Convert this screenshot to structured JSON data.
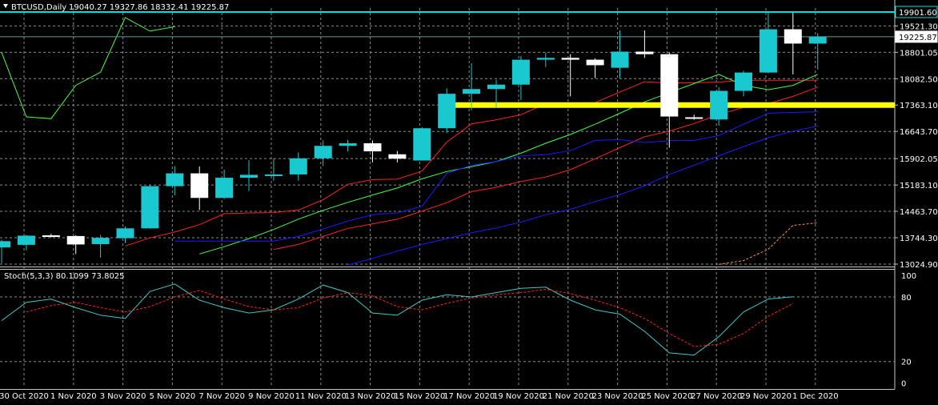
{
  "header": {
    "symbol_label": "BTCUSD,Daily",
    "ohlc_label": "19040.27 19327.86 18332.41 19225.87",
    "stoch_label": "Stoch(5,3,3) 80.1099 73.8025"
  },
  "colors": {
    "bull_candle": "#1ac8d0",
    "bear_candle": "#ffffff",
    "grid": "#8a8a8a",
    "highlight_line": "#ffff00",
    "resistance_line": "#00e0e0",
    "ma_fast": "#ff2020",
    "ma_mid": "#40ff40",
    "ma_slow": "#1a1aff",
    "stoch_main": "#40c8c8",
    "stoch_signal": "#ff2020",
    "dotted_indicator": "#ff9040"
  },
  "chart_data": [
    {
      "type": "candlestick",
      "title": "BTCUSD,Daily",
      "y_axis_labels": [
        "19521.30",
        "18801.05",
        "18082.50",
        "17363.10",
        "16643.70",
        "15902.05",
        "15183.10",
        "14463.70",
        "13744.30",
        "13024.90"
      ],
      "y_axis_values": [
        19521.3,
        18801.05,
        18082.5,
        17363.1,
        16643.7,
        15902.05,
        15183.1,
        14463.7,
        13744.3,
        13024.9
      ],
      "ylim": [
        12980,
        20010
      ],
      "price_labels": [
        {
          "text": "19901.60",
          "value": 19901.6,
          "style": "resistance"
        },
        {
          "text": "19225.87",
          "value": 19225.87,
          "style": "current"
        }
      ],
      "horizontal_levels": [
        {
          "name": "resistance",
          "value": 19901.6
        },
        {
          "name": "current-price",
          "value": 19225.87
        },
        {
          "name": "highlighted-support",
          "value": 17363.1,
          "from_index": 18
        }
      ],
      "x_labels": [
        "30 Oct 2020",
        "1 Nov 2020",
        "3 Nov 2020",
        "5 Nov 2020",
        "7 Nov 2020",
        "9 Nov 2020",
        "11 Nov 2020",
        "13 Nov 2020",
        "15 Nov 2020",
        "17 Nov 2020",
        "19 Nov 2020",
        "21 Nov 2020",
        "23 Nov 2020",
        "25 Nov 2020",
        "27 Nov 2020",
        "29 Nov 2020",
        "1 Dec 2020"
      ],
      "candles": [
        {
          "o": 13480,
          "h": 13690,
          "l": 13050,
          "c": 13650
        },
        {
          "o": 13550,
          "h": 13820,
          "l": 13400,
          "c": 13800
        },
        {
          "o": 13810,
          "h": 13850,
          "l": 13750,
          "c": 13780
        },
        {
          "o": 13790,
          "h": 13810,
          "l": 13300,
          "c": 13560
        },
        {
          "o": 13570,
          "h": 13820,
          "l": 13200,
          "c": 13740
        },
        {
          "o": 13730,
          "h": 14050,
          "l": 13600,
          "c": 14000
        },
        {
          "o": 14000,
          "h": 15200,
          "l": 13990,
          "c": 15150
        },
        {
          "o": 15150,
          "h": 15700,
          "l": 14900,
          "c": 15500
        },
        {
          "o": 15500,
          "h": 15690,
          "l": 14500,
          "c": 14830
        },
        {
          "o": 14830,
          "h": 15600,
          "l": 14800,
          "c": 15380
        },
        {
          "o": 15380,
          "h": 15860,
          "l": 15020,
          "c": 15460
        },
        {
          "o": 15460,
          "h": 15900,
          "l": 15300,
          "c": 15470
        },
        {
          "o": 15470,
          "h": 16070,
          "l": 15300,
          "c": 15910
        },
        {
          "o": 15910,
          "h": 16400,
          "l": 15700,
          "c": 16250
        },
        {
          "o": 16250,
          "h": 16410,
          "l": 16100,
          "c": 16320
        },
        {
          "o": 16320,
          "h": 16400,
          "l": 15800,
          "c": 16100
        },
        {
          "o": 16020,
          "h": 16110,
          "l": 15800,
          "c": 15900
        },
        {
          "o": 15850,
          "h": 16760,
          "l": 15850,
          "c": 16730
        },
        {
          "o": 16730,
          "h": 17820,
          "l": 16600,
          "c": 17670
        },
        {
          "o": 17670,
          "h": 18500,
          "l": 17220,
          "c": 17800
        },
        {
          "o": 17800,
          "h": 18050,
          "l": 17300,
          "c": 17920
        },
        {
          "o": 17920,
          "h": 18700,
          "l": 17500,
          "c": 18600
        },
        {
          "o": 18600,
          "h": 18800,
          "l": 18400,
          "c": 18650
        },
        {
          "o": 18650,
          "h": 18750,
          "l": 17600,
          "c": 18600
        },
        {
          "o": 18600,
          "h": 18640,
          "l": 18100,
          "c": 18450
        },
        {
          "o": 18380,
          "h": 19400,
          "l": 18100,
          "c": 18820
        },
        {
          "o": 18820,
          "h": 19400,
          "l": 18650,
          "c": 18750
        },
        {
          "o": 18750,
          "h": 18790,
          "l": 16200,
          "c": 17050
        },
        {
          "o": 17030,
          "h": 17100,
          "l": 16960,
          "c": 17000
        },
        {
          "o": 16970,
          "h": 17850,
          "l": 16800,
          "c": 17750
        },
        {
          "o": 17750,
          "h": 18300,
          "l": 17600,
          "c": 18250
        },
        {
          "o": 18250,
          "h": 19880,
          "l": 18230,
          "c": 19430
        },
        {
          "o": 19430,
          "h": 19880,
          "l": 18200,
          "c": 19040
        },
        {
          "o": 19040,
          "h": 19328,
          "l": 18332,
          "c": 19226
        }
      ],
      "series": [
        {
          "type": "line",
          "values": [
            null,
            null,
            null,
            null,
            null,
            13520,
            13740,
            13900,
            14100,
            14400,
            14420,
            14430,
            14500,
            14780,
            15200,
            15330,
            15340,
            15560,
            16350,
            16850,
            16960,
            17100,
            17400,
            17420,
            17430,
            17720,
            18000,
            17960,
            17970,
            17990,
            18040,
            18040,
            18040,
            18040
          ]
        },
        {
          "type": "line",
          "values": [
            null,
            null,
            null,
            null,
            null,
            null,
            null,
            null,
            null,
            null,
            null,
            13420,
            13560,
            13780,
            14000,
            14120,
            14250,
            14470,
            14700,
            15000,
            15120,
            15280,
            15400,
            15600,
            15900,
            16200,
            16500,
            16650,
            16860,
            17100,
            17300,
            17400,
            17600,
            17850
          ]
        },
        {
          "type": "line",
          "values": [
            null,
            null,
            null,
            null,
            null,
            null,
            null,
            null,
            13300,
            13500,
            13720,
            13970,
            14250,
            14490,
            14710,
            14910,
            15100,
            15350,
            15550,
            15680,
            15820,
            16050,
            16320,
            16560,
            16840,
            17140,
            17450,
            17700,
            17950,
            18200,
            17900,
            17780,
            17900,
            18200
          ]
        },
        {
          "type": "line",
          "values": [
            null,
            null,
            null,
            null,
            null,
            null,
            null,
            13650,
            13650,
            13650,
            13650,
            13650,
            13780,
            13980,
            14200,
            14370,
            14420,
            14600,
            15500,
            15720,
            15820,
            15980,
            16010,
            16120,
            16400,
            16420,
            16340,
            16390,
            16400,
            16530,
            16840,
            17140,
            17160,
            17180
          ]
        },
        {
          "type": "line",
          "values": [
            null,
            null,
            null,
            null,
            null,
            null,
            null,
            null,
            null,
            null,
            null,
            null,
            null,
            null,
            13000,
            13180,
            13380,
            13560,
            13720,
            13880,
            14010,
            14170,
            14370,
            14520,
            14730,
            14920,
            15160,
            15470,
            15720,
            15980,
            16230,
            16470,
            16650,
            16790
          ]
        },
        {
          "type": "line",
          "values": [
            null,
            null,
            null,
            null,
            null,
            null,
            null,
            null,
            null,
            null,
            null,
            null,
            null,
            null,
            null,
            null,
            null,
            null,
            null,
            null,
            null,
            null,
            null,
            null,
            null,
            null,
            null,
            null,
            null,
            13020,
            13120,
            13430,
            14080,
            14150
          ]
        },
        {
          "type": "line",
          "values": [
            18800,
            17040,
            16990,
            17900,
            18260,
            19750,
            19380,
            19500,
            null,
            null,
            null,
            null,
            null,
            null,
            null,
            null,
            null,
            null,
            null,
            null,
            null,
            null,
            null,
            null,
            null,
            null,
            null,
            null,
            null,
            null,
            null,
            null,
            null,
            null
          ]
        }
      ]
    },
    {
      "type": "line",
      "title": "Stoch(5,3,3) 80.1099 73.8025",
      "y_axis_labels": [
        "100",
        "80",
        "20",
        "0"
      ],
      "y_axis_values": [
        100,
        80,
        20,
        0
      ],
      "ylim": [
        -4,
        103
      ],
      "series": [
        {
          "values": [
            58,
            75,
            78,
            70,
            63,
            60,
            85,
            92,
            77,
            70,
            65,
            68,
            78,
            91,
            84,
            65,
            63,
            77,
            82,
            80,
            84,
            88,
            89,
            77,
            68,
            64,
            48,
            28,
            26,
            43,
            66,
            78,
            80.11
          ]
        },
        {
          "values": [
            null,
            66,
            72,
            75,
            70,
            66,
            71,
            80,
            86,
            78,
            71,
            68,
            70,
            79,
            84,
            81,
            71,
            68,
            74,
            79,
            82,
            84,
            87,
            83,
            77,
            70,
            60,
            46,
            34,
            36,
            46,
            62,
            73.8
          ]
        }
      ]
    }
  ]
}
